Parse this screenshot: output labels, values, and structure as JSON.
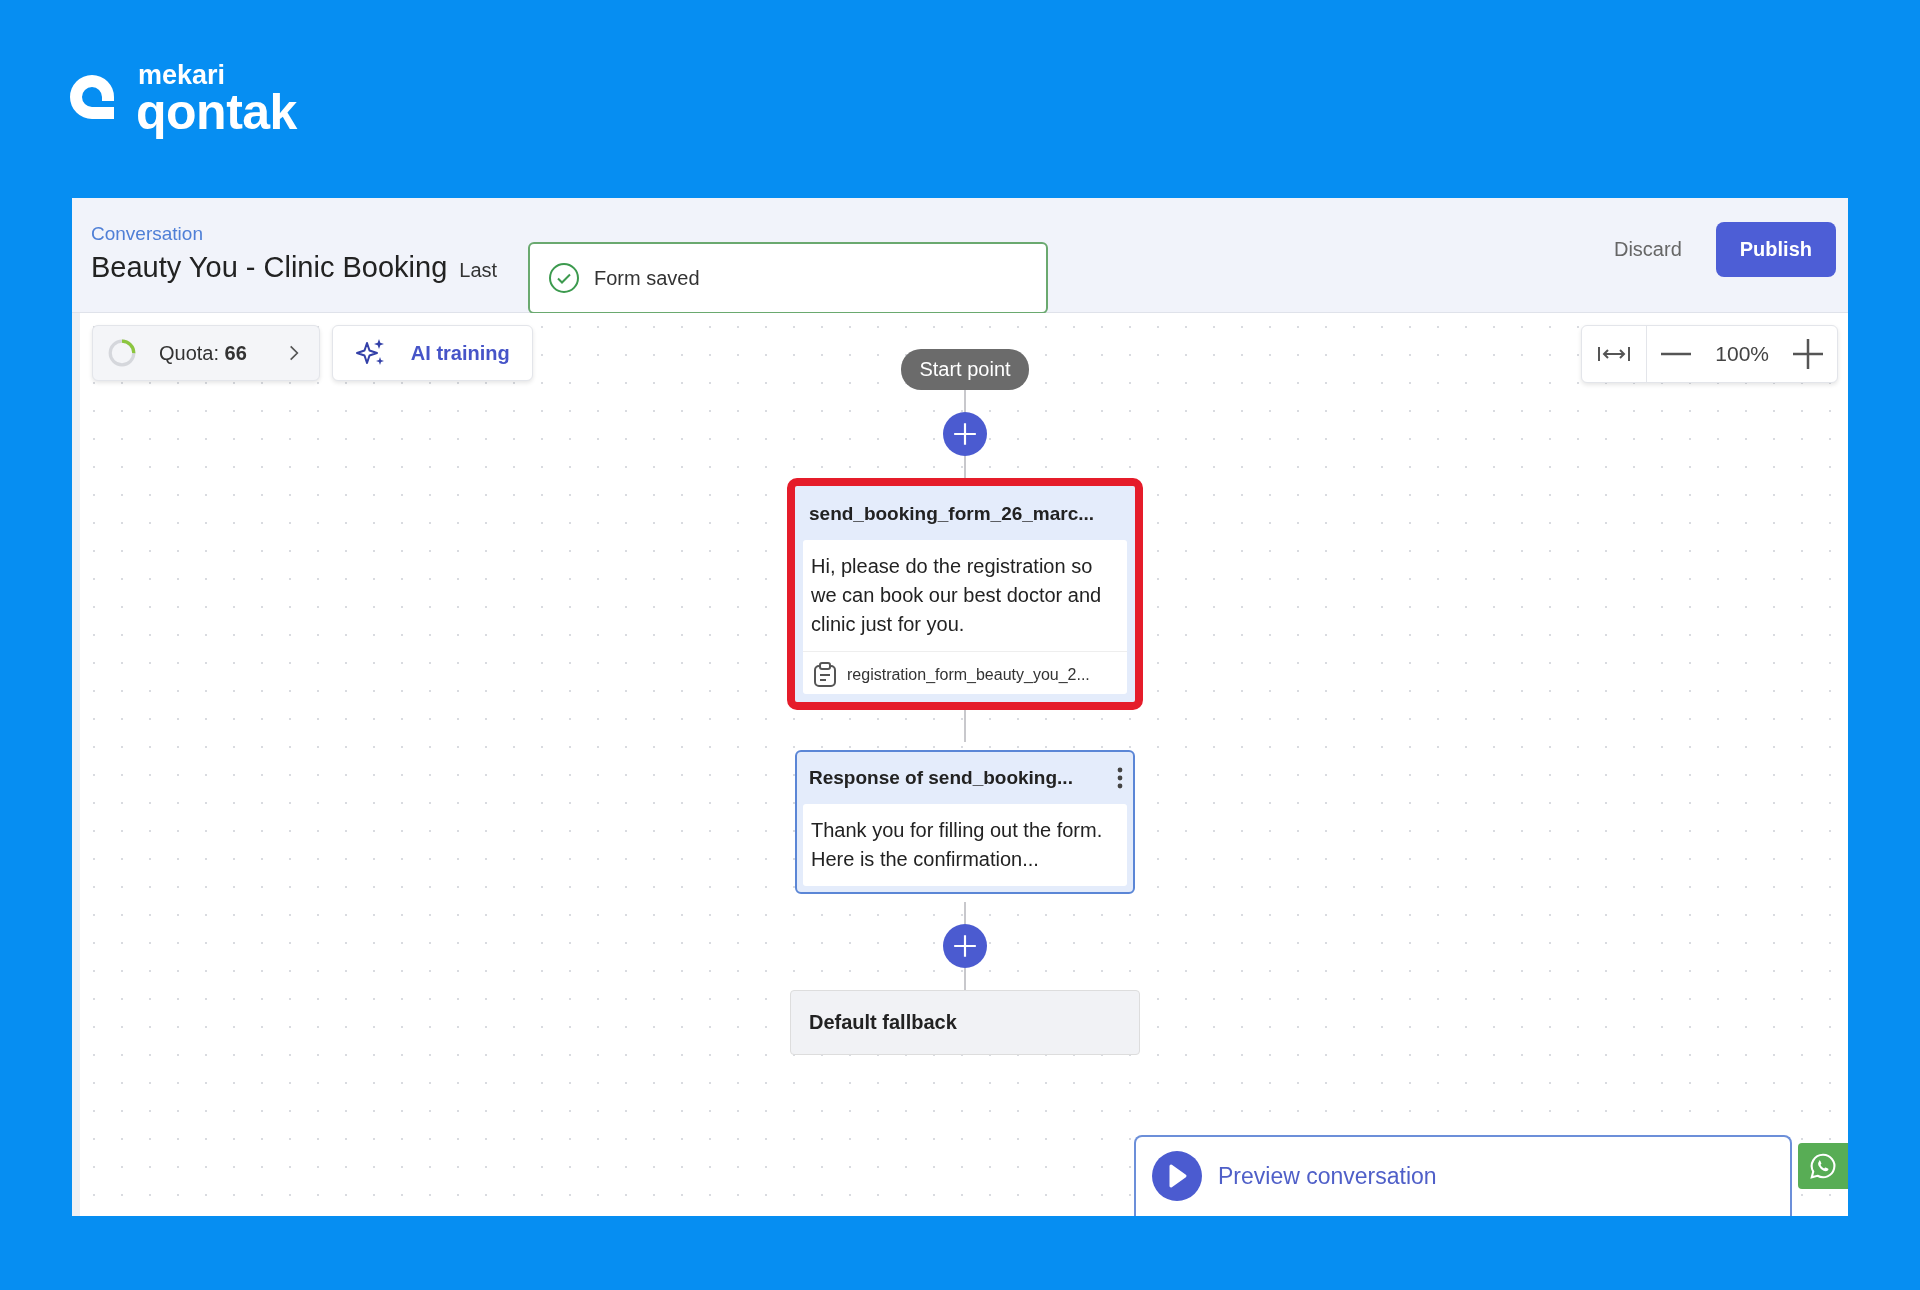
{
  "brand": {
    "parent": "mekari",
    "name": "qontak"
  },
  "header": {
    "breadcrumb": "Conversation",
    "title": "Beauty You - Clinic Booking",
    "last_saved": "Last",
    "actions": [
      {
        "label": "Discard",
        "kind": "text"
      },
      {
        "label": "Publish",
        "kind": "primary"
      }
    ]
  },
  "toast": {
    "message": "Form saved"
  },
  "toolbar": {
    "quota_label": "Quota:",
    "quota_value": "66",
    "quota_meter": {
      "level": 0.25
    },
    "ai_training": "AI training"
  },
  "zoom": {
    "value": "100%"
  },
  "flow": [
    {
      "kind": "start",
      "title": "Start point"
    },
    {
      "kind": "add"
    },
    {
      "kind": "message",
      "title": "send_booking_form_26_marc...",
      "body": "Hi, please do the registration so we can book our best doctor and clinic just for you.",
      "attachment": "registration_form_beauty_you_2...",
      "highlighted": true,
      "selected": false
    },
    {
      "kind": "response",
      "title": "Response of send_booking...",
      "body": "Thank you for filling out the form. Here is the confirmation...",
      "highlighted": false,
      "selected": true
    },
    {
      "kind": "add"
    },
    {
      "kind": "fallback",
      "title": "Default fallback"
    }
  ],
  "preview": {
    "label": "Preview conversation"
  }
}
